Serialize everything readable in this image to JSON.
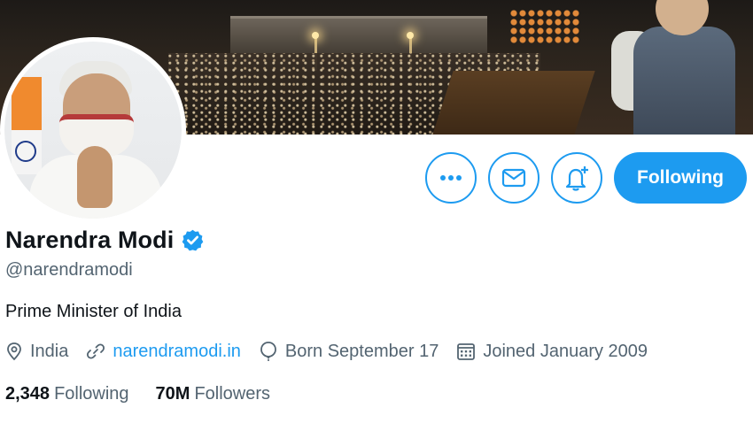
{
  "profile": {
    "display_name": "Narendra Modi",
    "handle": "@narendramodi",
    "bio": "Prime Minister of India",
    "location": "India",
    "website": "narendramodi.in",
    "birthday": "Born September 17",
    "joined": "Joined January 2009"
  },
  "actions": {
    "more_icon": "more-icon",
    "message_icon": "envelope-icon",
    "notify_icon": "bell-plus-icon",
    "follow_label": "Following"
  },
  "stats": {
    "following_count": "2,348",
    "following_label": "Following",
    "followers_count": "70M",
    "followers_label": "Followers"
  },
  "colors": {
    "accent": "#1d9bf0",
    "text_primary": "#0f1419",
    "text_secondary": "#536471"
  }
}
